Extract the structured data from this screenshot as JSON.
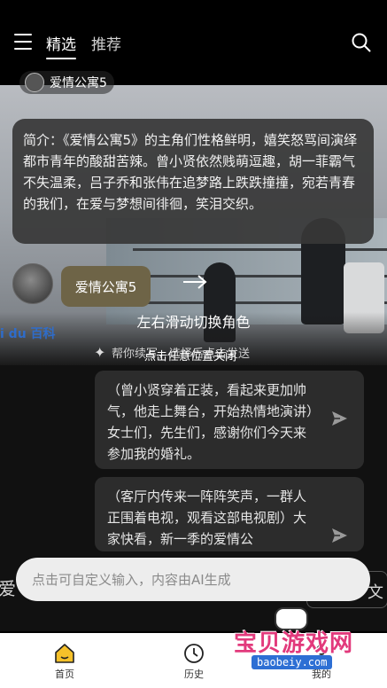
{
  "topbar": {
    "tabs": [
      {
        "label": "精选",
        "active": true
      },
      {
        "label": "推荐",
        "active": false
      }
    ]
  },
  "role_chip": {
    "label": "爱情公寓5"
  },
  "intro": {
    "text": "简介：《爱情公寓5》的主角们性格鲜明，嬉笑怒骂间演绎都市青年的酸甜苦辣。曾小贤依然贱萌逗趣，胡一菲霸气不失温柔，吕子乔和张伟在追梦路上跌跌撞撞，宛若青春的我们，在爱与梦想间徘徊，笑泪交织。"
  },
  "role_button": {
    "label": "爱情公寓5"
  },
  "swipe_hint": "左右滑动切换角色",
  "watermark": "i du 百科",
  "helper": {
    "text": "帮你续写，选择后点击发送",
    "close_hint": "点击任意位置关闭"
  },
  "suggestions": [
    {
      "text": "（曾小贤穿着正装，看起来更加帅气，他走上舞台，开始热情地演讲）女士们，先生们，感谢你们今天来参加我的婚礼。"
    },
    {
      "text": "（客厅内传来一阵阵笑声，一群人正围着电视，观看这部电视剧）大家快看，新一季的爱情公"
    }
  ],
  "side_text": {
    "left": "爱",
    "right": "文"
  },
  "input": {
    "placeholder": "点击可自定义输入，内容由AI生成"
  },
  "bottom_nav": [
    {
      "label": "首页",
      "icon": "home-icon"
    },
    {
      "label": "历史",
      "icon": "clock-icon"
    },
    {
      "label": "我的",
      "icon": "profile-icon"
    }
  ],
  "logo": {
    "brand": "宝贝游戏网",
    "url": "baobeiy.com"
  },
  "colors": {
    "accent": "#f6c12a",
    "role_button": "#6e6447",
    "card": "#2c2c2c"
  }
}
